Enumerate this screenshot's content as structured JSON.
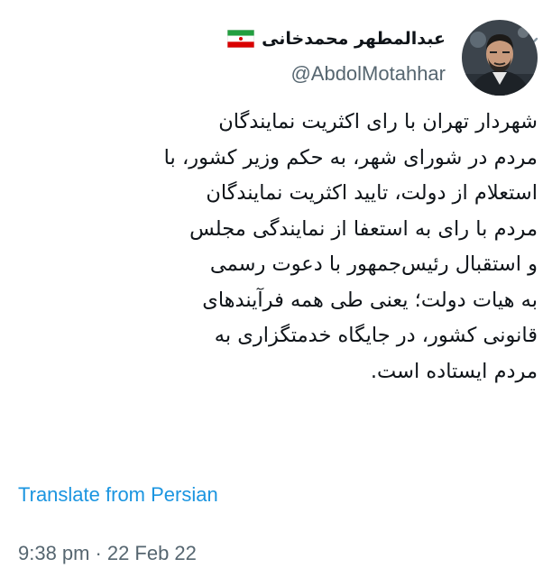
{
  "tweet": {
    "display_name": "عبدالمطهر محمدخانی",
    "handle": "@AbdolMotahhar",
    "flag_icon": "iran-flag-icon",
    "menu_icon": "chevron-down-icon",
    "text_lines": [
      "شهردار تهران با رای اکثریت نمایندگان",
      "مردم در شورای شهر، به حکم وزیر کشور، با",
      "استعلام از دولت، تایید اکثریت نمایندگان",
      "مردم با رای به استعفا از نمایندگی مجلس",
      "و استقبال رئیس‌جمهور با دعوت رسمی",
      "به هیات دولت؛ یعنی طی همه فرآیندهای",
      "قانونی کشور، در جایگاه خدمتگزاری به",
      "مردم ایستاده است."
    ],
    "translate_link": "Translate from Persian",
    "time": "9:38 pm",
    "separator": "·",
    "date": "22 Feb 22"
  },
  "colors": {
    "link": "#1b95e0",
    "secondary_text": "#566670",
    "primary_text": "#0f1419",
    "flag_green": "#239f40",
    "flag_red": "#da0000"
  }
}
